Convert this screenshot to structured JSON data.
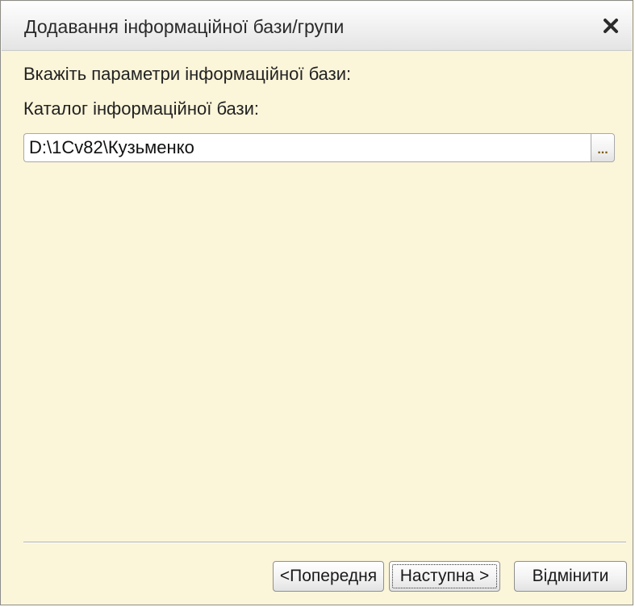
{
  "window": {
    "title": "Додавання інформаційної бази/групи",
    "close_icon": "close-icon"
  },
  "form": {
    "params_label": "Вкажіть параметри інформаційної бази:",
    "catalog_label": "Каталог інформаційної бази:",
    "catalog_value": "D:\\1Cv82\\Кузьменко",
    "browse_label": "..."
  },
  "buttons": {
    "previous": "<Попередня",
    "next": "Наступна >",
    "cancel": "Відмінити"
  },
  "colors": {
    "dialog_background": "#fbf5d9",
    "titlebar_background": "#f0f0f0",
    "browse_dots": "#7a5a00"
  }
}
